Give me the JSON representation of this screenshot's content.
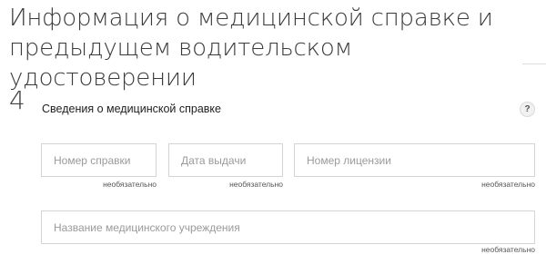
{
  "page": {
    "title": "Информация о медицинской справке и предыдущем водительском удостоверении"
  },
  "section": {
    "number": "4",
    "title": "Сведения о медицинской справке",
    "help_label": "?"
  },
  "fields": {
    "certificate_number": {
      "placeholder": "Номер справки",
      "value": "",
      "note": "необязательно"
    },
    "issue_date": {
      "placeholder": "Дата выдачи",
      "value": "",
      "note": "необязательно"
    },
    "license_number": {
      "placeholder": "Номер лицензии",
      "value": "",
      "note": "необязательно"
    },
    "institution_name": {
      "placeholder": "Название медицинского учреждения",
      "value": "",
      "note": "необязательно"
    }
  },
  "icons": {
    "help": "question-circle-icon"
  }
}
